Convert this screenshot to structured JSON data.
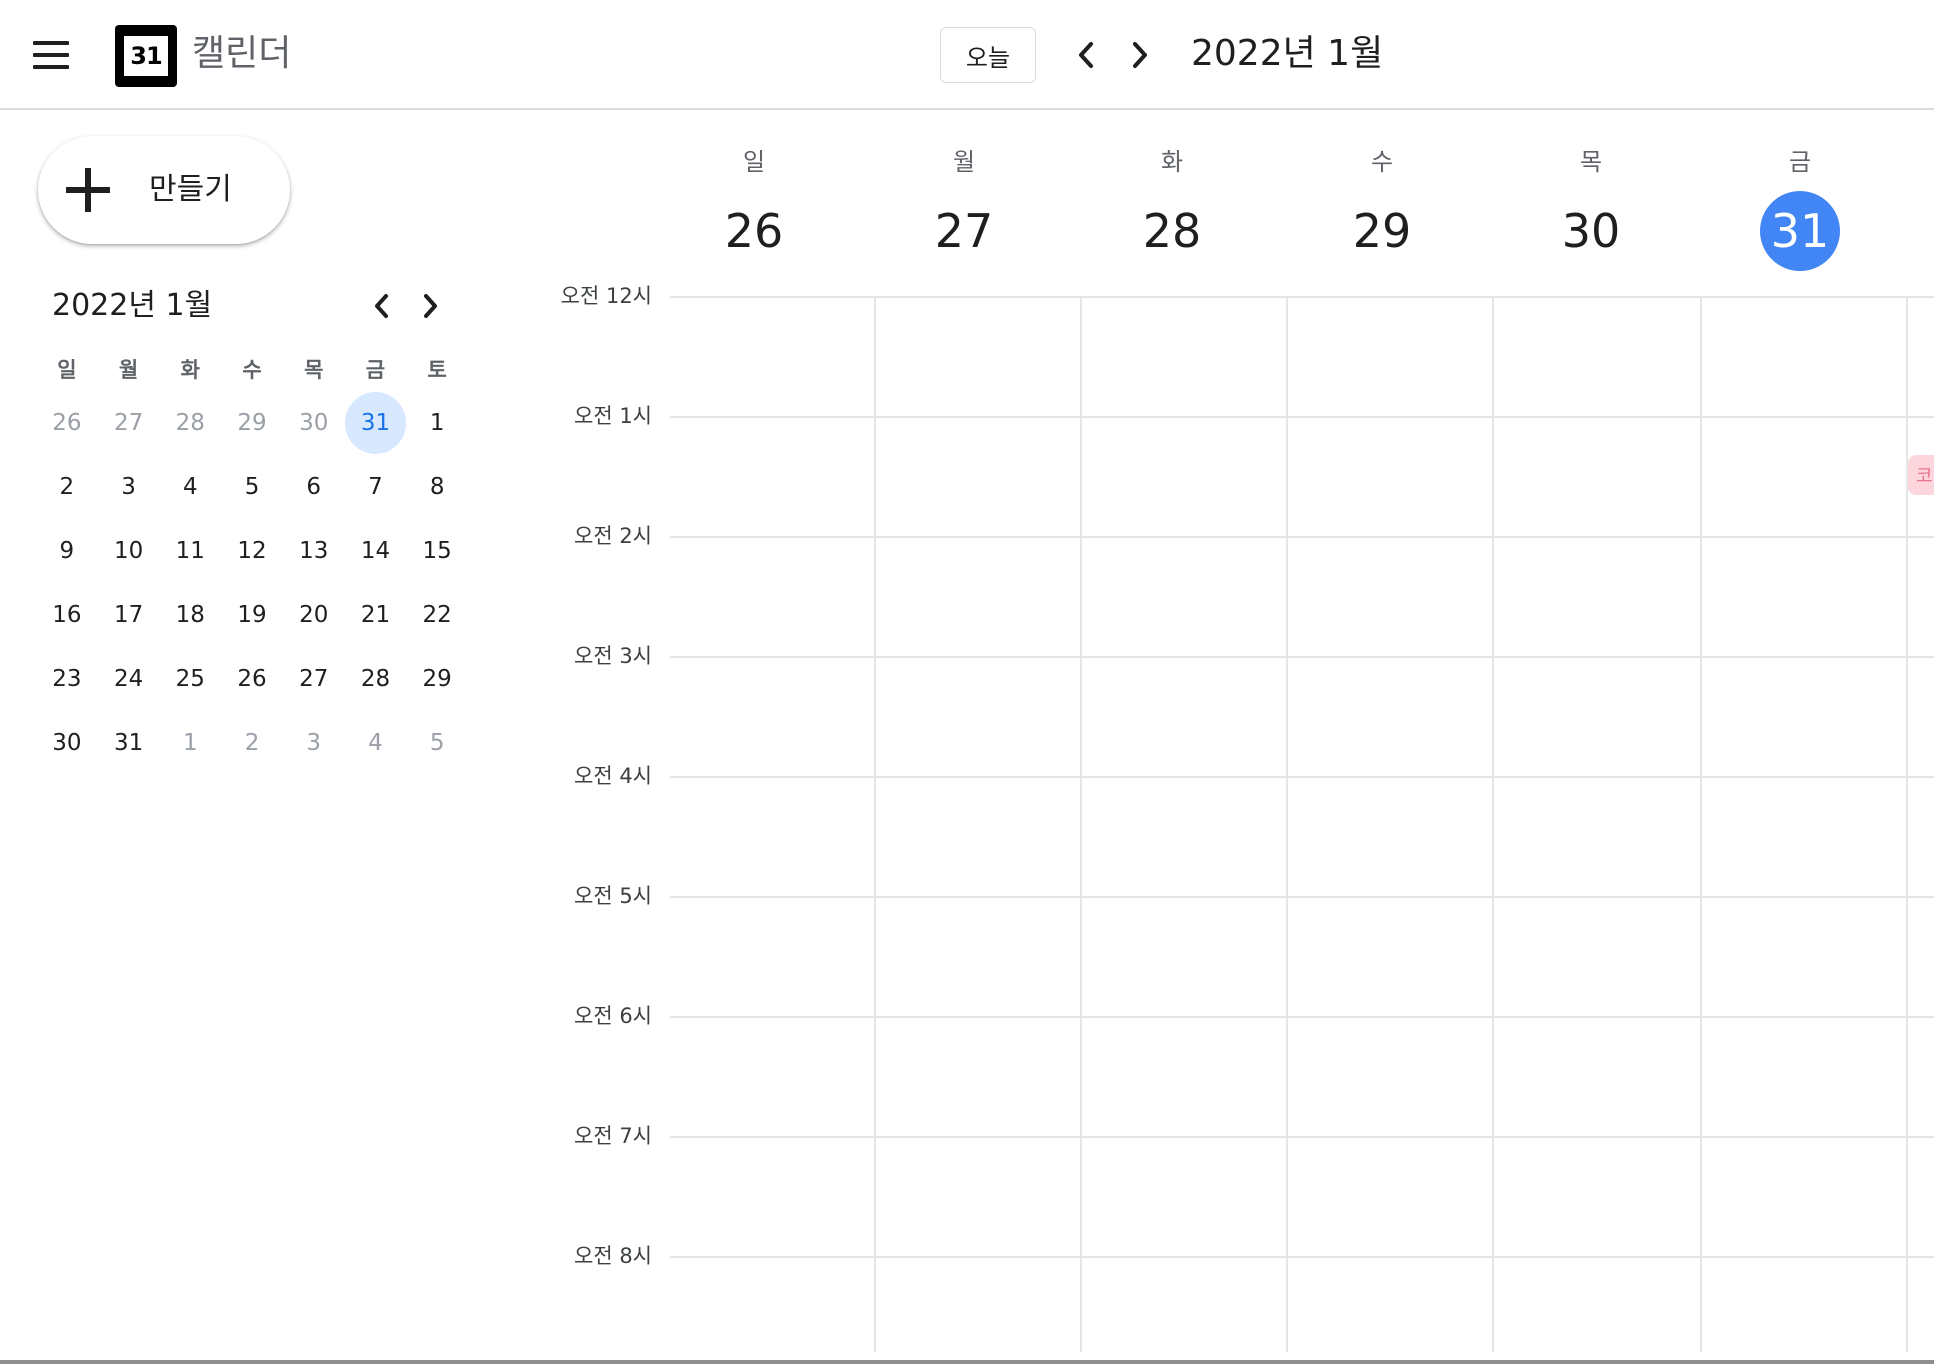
{
  "app": {
    "name": "캘린더",
    "logo_number": "31"
  },
  "header": {
    "today_label": "오늘",
    "current_period": "2022년 1월"
  },
  "sidebar": {
    "create_label": "만들기",
    "mini_calendar": {
      "title": "2022년 1월",
      "weekdays": [
        "일",
        "월",
        "화",
        "수",
        "목",
        "금",
        "토"
      ],
      "weeks": [
        [
          "26",
          "27",
          "28",
          "29",
          "30",
          "31",
          "1"
        ],
        [
          "2",
          "3",
          "4",
          "5",
          "6",
          "7",
          "8"
        ],
        [
          "9",
          "10",
          "11",
          "12",
          "13",
          "14",
          "15"
        ],
        [
          "16",
          "17",
          "18",
          "19",
          "20",
          "21",
          "22"
        ],
        [
          "23",
          "24",
          "25",
          "26",
          "27",
          "28",
          "29"
        ],
        [
          "30",
          "31",
          "1",
          "2",
          "3",
          "4",
          "5"
        ]
      ],
      "selected_date": "31"
    }
  },
  "week_view": {
    "days": [
      {
        "name": "일",
        "date": "26",
        "today": false
      },
      {
        "name": "월",
        "date": "27",
        "today": false
      },
      {
        "name": "화",
        "date": "28",
        "today": false
      },
      {
        "name": "수",
        "date": "29",
        "today": false
      },
      {
        "name": "목",
        "date": "30",
        "today": false
      },
      {
        "name": "금",
        "date": "31",
        "today": true
      }
    ],
    "hours": [
      "오전 12시",
      "오전 1시",
      "오전 2시",
      "오전 3시",
      "오전 4시",
      "오전 5시",
      "오전 6시",
      "오전 7시",
      "오전 8시"
    ],
    "partial_event_text": "코"
  },
  "colors": {
    "accent": "#4285f4",
    "selected_bg": "#d7e8ff",
    "selected_text": "#1a73e8",
    "gridline": "#e5e5e5",
    "event_bg": "#fcd5dd"
  },
  "icons": {
    "menu": "menu-icon",
    "previous": "chevron-left-icon",
    "next": "chevron-right-icon",
    "create": "plus-icon"
  }
}
